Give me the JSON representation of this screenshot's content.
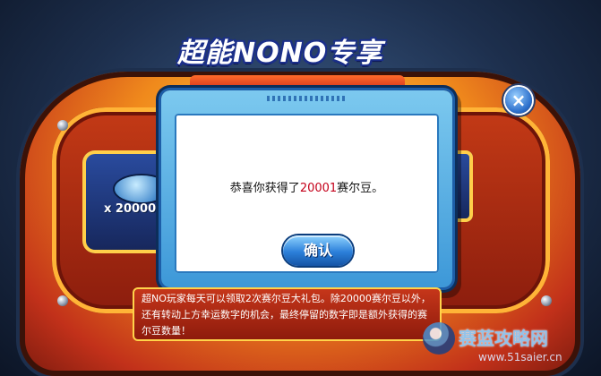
{
  "game": {
    "title": "超能NONO专享",
    "reward_badge": "x 20000"
  },
  "dialog": {
    "message_prefix": "恭喜你获得了",
    "amount": "20001",
    "message_suffix": "赛尔豆。",
    "confirm_label": "确认",
    "close_symbol": "×"
  },
  "info": {
    "text": "超NO玩家每天可以领取2次赛尔豆大礼包。除20000赛尔豆以外，还有转动上方幸运数字的机会，最终停留的数字即是额外获得的赛尔豆数量！"
  },
  "watermark": {
    "name": "赛蓝攻略网",
    "url": "www.51saier.cn"
  },
  "colors": {
    "amount_red": "#c4001a",
    "dialog_blue": "#3d98d8",
    "frame_orange": "#f08a1c"
  }
}
